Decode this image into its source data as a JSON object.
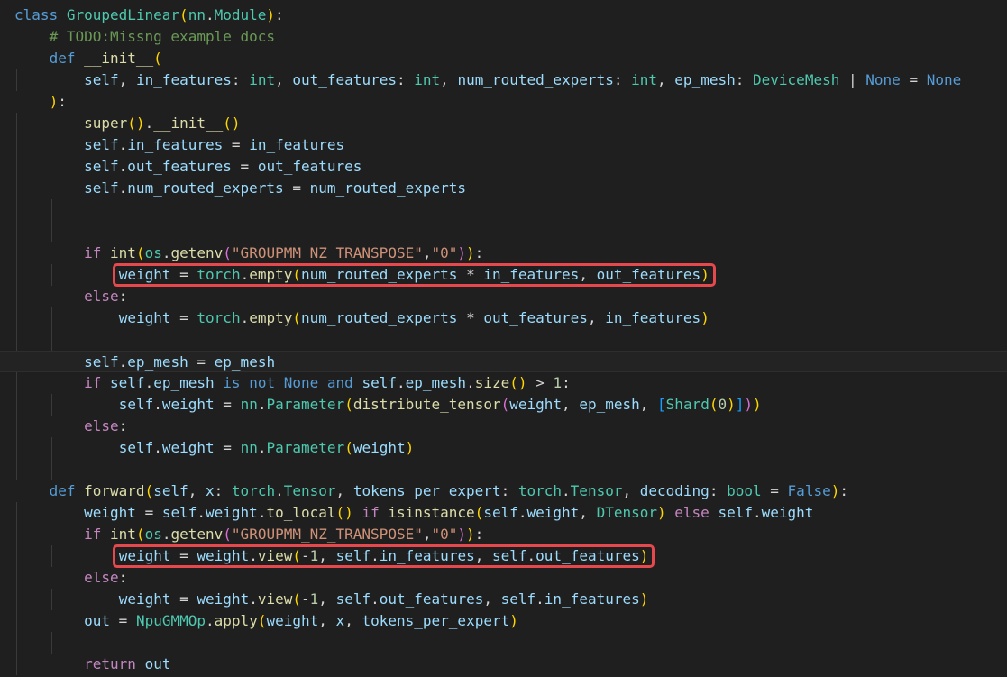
{
  "editor": {
    "language": "python",
    "lines": [
      "class GroupedLinear(nn.Module):",
      "    # TODO:Missng example docs",
      "    def __init__(",
      "        self, in_features: int, out_features: int, num_routed_experts: int, ep_mesh: DeviceMesh | None = None",
      "    ):",
      "        super().__init__()",
      "        self.in_features = in_features",
      "        self.out_features = out_features",
      "        self.num_routed_experts = num_routed_experts",
      "",
      "",
      "        if int(os.getenv(\"GROUPMM_NZ_TRANSPOSE\",\"0\")):",
      "            weight = torch.empty(num_routed_experts * in_features, out_features)",
      "        else:",
      "            weight = torch.empty(num_routed_experts * out_features, in_features)",
      "",
      "        self.ep_mesh = ep_mesh",
      "        if self.ep_mesh is not None and self.ep_mesh.size() > 1:",
      "            self.weight = nn.Parameter(distribute_tensor(weight, ep_mesh, [Shard(0)]))",
      "        else:",
      "            self.weight = nn.Parameter(weight)",
      "",
      "    def forward(self, x: torch.Tensor, tokens_per_expert: torch.Tensor, decoding: bool = False):",
      "        weight = self.weight.to_local() if isinstance(self.weight, DTensor) else self.weight",
      "        if int(os.getenv(\"GROUPMM_NZ_TRANSPOSE\",\"0\")):",
      "            weight = weight.view(-1, self.in_features, self.out_features)",
      "        else:",
      "            weight = weight.view(-1, self.out_features, self.in_features)",
      "        out = NpuGMMOp.apply(weight, x, tokens_per_expert)",
      "",
      "        return out"
    ],
    "highlighted_lines": [
      12,
      25
    ],
    "current_line": 16,
    "colors": {
      "background": "#1f1f1f",
      "highlight_border": "#e5484d",
      "keyword": "#569cd6",
      "control": "#c586c0",
      "function": "#dcdcaa",
      "class": "#4ec9b0",
      "variable": "#9cdcfe",
      "string": "#ce9178",
      "comment": "#6a9955",
      "number": "#b5cea8"
    }
  }
}
